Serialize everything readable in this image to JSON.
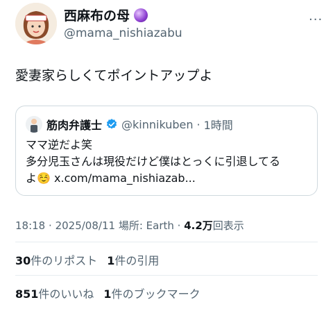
{
  "author": {
    "display_name": "西麻布の母",
    "handle": "@mama_nishiazabu"
  },
  "tweet": {
    "text": "愛妻家らしくてポイントアップよ"
  },
  "quote": {
    "display_name": "筋肉弁護士",
    "handle": "@kinnikuben",
    "separator": "·",
    "time": "1時間",
    "lines": [
      "ママ逆だよ笑",
      "多分児玉さんは現役だけど僕はとっくに引退してる",
      "よ☺️ x.com/mama_nishiazab..."
    ]
  },
  "meta": {
    "time": "18:18",
    "dot": "·",
    "date": "2025/08/11",
    "place": "場所: Earth",
    "views_value": "4.2万",
    "views_label": "回表示"
  },
  "stats": {
    "reposts_value": "30",
    "reposts_label": "件のリポスト",
    "quotes_value": "1",
    "quotes_label": "件の引用",
    "likes_value": "851",
    "likes_label": "件のいいね",
    "bookmarks_value": "1",
    "bookmarks_label": "件のブックマーク"
  },
  "icons": [
    "more-icon",
    "verified-badge-icon",
    "crystal-ball-icon"
  ],
  "colors": {
    "verified": "#1d9bf0",
    "secondary_text": "#536471"
  }
}
